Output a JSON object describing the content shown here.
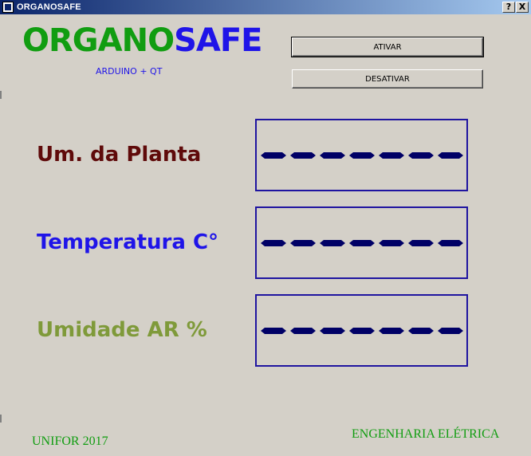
{
  "window": {
    "title": "ORGANOSAFE",
    "help_button": "?",
    "close_button": "X"
  },
  "header": {
    "brand_part1": "ORGANO",
    "brand_part2": "SAFE",
    "subtitle": "ARDUINO + QT"
  },
  "controls": {
    "activate_label": "ATIVAR",
    "deactivate_label": "DESATIVAR"
  },
  "sensors": [
    {
      "label": "Um. da Planta",
      "color": "#5f0a0a",
      "segments": 7
    },
    {
      "label": "Temperatura C°",
      "color": "#1f14e8",
      "segments": 7
    },
    {
      "label": "Umidade AR %",
      "color": "#7f9a3a",
      "segments": 7
    }
  ],
  "footer": {
    "left": "UNIFOR 2017",
    "right": "ENGENHARIA ELÉTRICA"
  },
  "colors": {
    "green": "#119d11",
    "blue": "#1f14e8",
    "lcd_segment": "#000066"
  }
}
